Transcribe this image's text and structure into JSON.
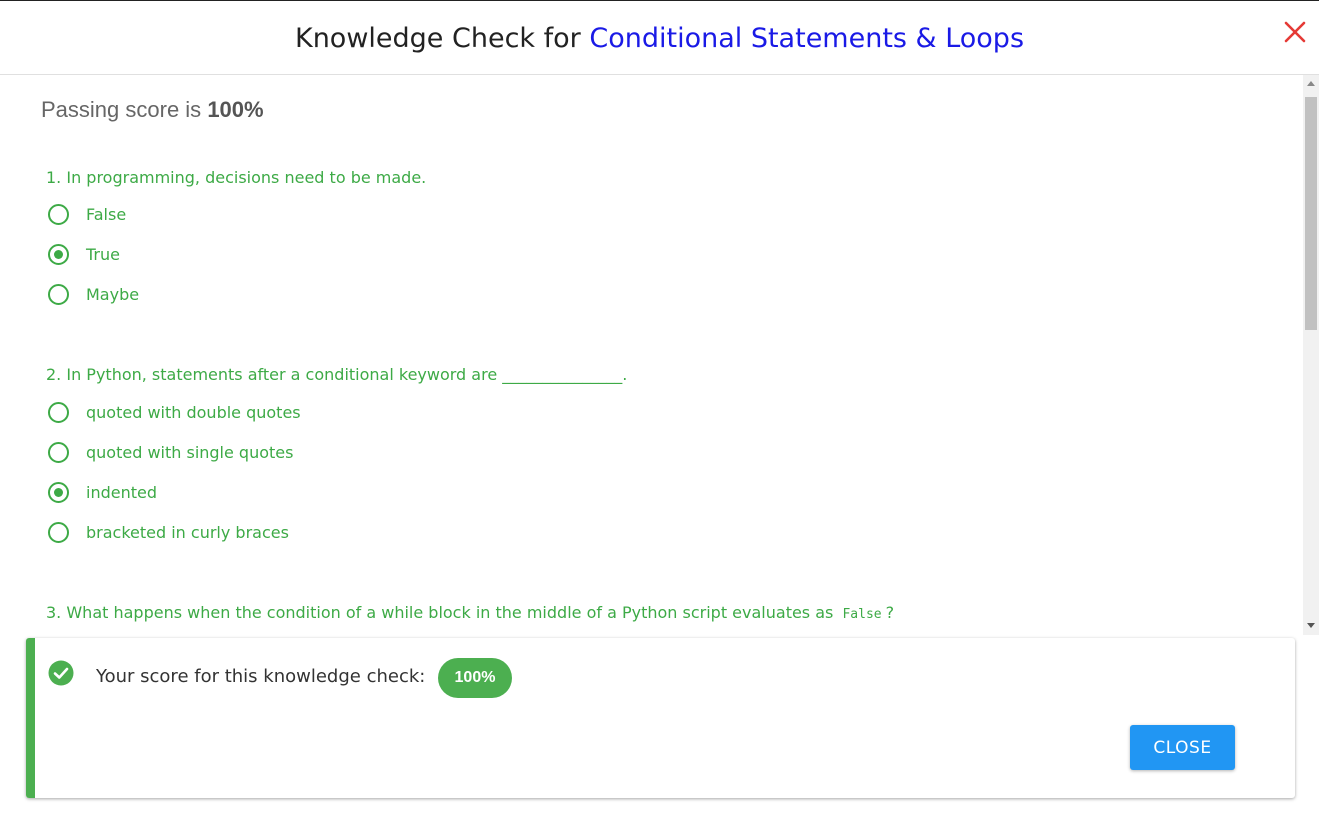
{
  "header": {
    "title_prefix": "Knowledge Check for",
    "title_topic": "Conditional Statements & Loops"
  },
  "passing_label": "Passing score is",
  "passing_value": "100%",
  "questions": [
    {
      "text": "1. In programming, decisions need to be made.",
      "options": [
        {
          "label": "False",
          "checked": false
        },
        {
          "label": "True",
          "checked": true
        },
        {
          "label": "Maybe",
          "checked": false
        }
      ]
    },
    {
      "text": "2. In Python, statements after a conditional keyword are _______________.",
      "options": [
        {
          "label": "quoted with double quotes",
          "checked": false
        },
        {
          "label": "quoted with single quotes",
          "checked": false
        },
        {
          "label": "indented",
          "checked": true
        },
        {
          "label": "bracketed in curly braces",
          "checked": false
        }
      ]
    },
    {
      "text_before": "3. What happens when the condition of a while block in the middle of a Python script evaluates as",
      "code": "False",
      "text_after": "?"
    }
  ],
  "result": {
    "label": "Your score for this knowledge check:",
    "score": "100%",
    "close_label": "CLOSE"
  },
  "colors": {
    "accent_blue": "#1a1ae6",
    "success_green": "#4caf50",
    "question_green": "#3daa46",
    "close_red": "#e53935",
    "button_blue": "#2196f3"
  },
  "icons": {
    "close": "close-icon",
    "check": "check-circle-icon",
    "radio_selected": "radio-checked-icon",
    "radio_unselected": "radio-unchecked-icon"
  }
}
